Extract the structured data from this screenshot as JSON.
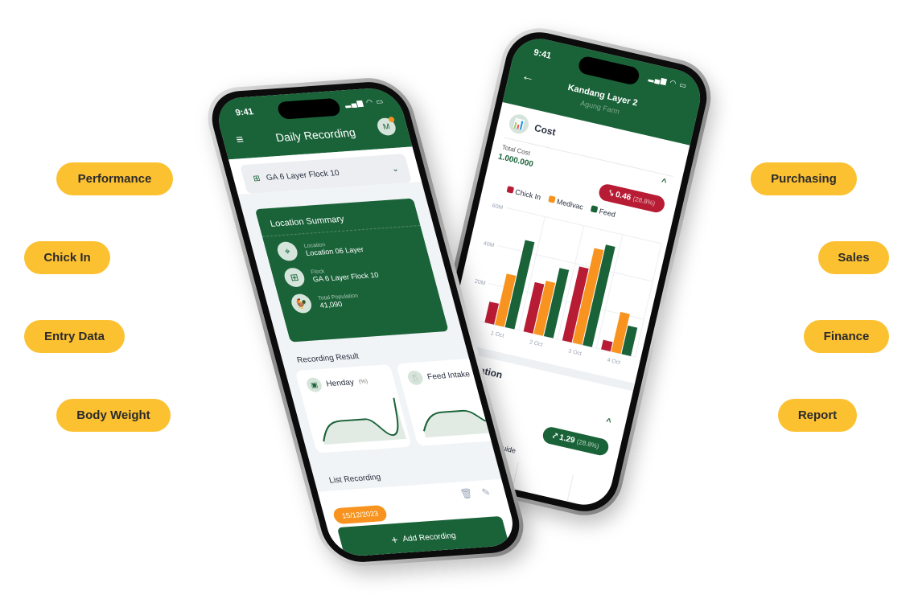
{
  "features_left": [
    {
      "label": "Performance"
    },
    {
      "label": "Chick In"
    },
    {
      "label": "Entry Data"
    },
    {
      "label": "Body Weight"
    }
  ],
  "features_right": [
    {
      "label": "Purchasing"
    },
    {
      "label": "Sales"
    },
    {
      "label": "Finance"
    },
    {
      "label": "Report"
    }
  ],
  "colors": {
    "brand_green": "#1a6339",
    "accent_yellow": "#fcc131",
    "chick_in": "#b71c34",
    "medivac": "#f7931e",
    "feed": "#1a6339"
  },
  "daily_phone": {
    "time": "9:41",
    "title": "Daily Recording",
    "avatar": "M",
    "flock_select": "GA 6 Layer Flock 10",
    "summary": {
      "title": "Location Summary",
      "rows": [
        {
          "label": "Location",
          "value": "Location 06 Layer",
          "icon": "location-pin-icon"
        },
        {
          "label": "Flock",
          "value": "GA 6 Layer Flock 10",
          "icon": "grid-icon"
        },
        {
          "label": "Total Population",
          "value": "41,090",
          "icon": "chicken-icon"
        }
      ]
    },
    "recording_result": "Recording Result",
    "cards": [
      {
        "title": "Henday",
        "unit": "(%)"
      },
      {
        "title": "Feed Intake",
        "unit": "(%)"
      }
    ],
    "list_title": "List Recording",
    "list_date": "15/12/2023",
    "add_button": "Add Recording"
  },
  "cost_phone": {
    "time": "9:41",
    "title": "Kandang Layer 2",
    "subtitle": "Agung Farm",
    "section": "Cost",
    "total_label": "Total Cost",
    "total_value": "1.000.000",
    "badge_value": "0.46",
    "badge_pct": "(28.8%)",
    "section2": "Population",
    "badge2_value": "1.29",
    "badge2_pct": "(28.8%)",
    "legend2": "Standard Guide"
  },
  "chart_data": {
    "type": "bar",
    "categories": [
      "1 Oct",
      "2 Oct",
      "3 Oct",
      "4 Oct"
    ],
    "series": [
      {
        "name": "Chick In",
        "values": [
          11,
          26,
          39,
          5
        ]
      },
      {
        "name": "Medivac",
        "values": [
          27,
          28,
          50,
          21
        ]
      },
      {
        "name": "Feed",
        "values": [
          46,
          36,
          53,
          15
        ]
      }
    ],
    "yticks": [
      "20M",
      "40M",
      "60M"
    ],
    "ylim": [
      0,
      60
    ],
    "grid": true,
    "legend": "top"
  }
}
